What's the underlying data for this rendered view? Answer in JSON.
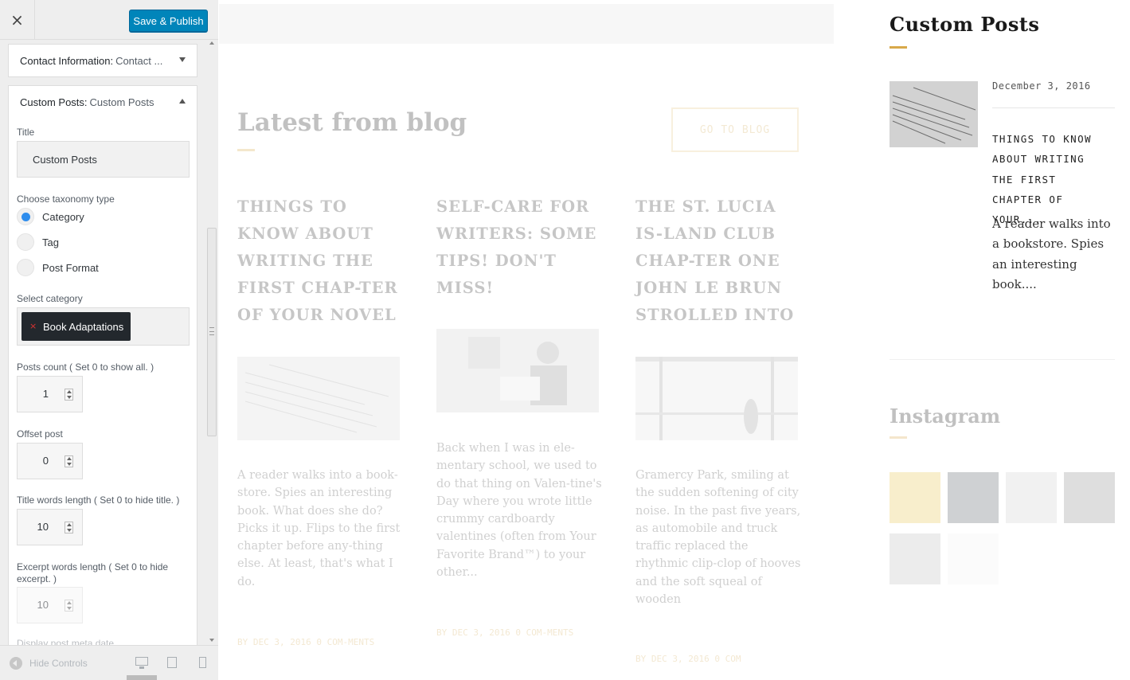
{
  "customizer": {
    "close_icon": "×",
    "publish_label": "Save & Publish",
    "contact_section": {
      "title": "Contact Information:",
      "subtitle": "Contact ..."
    },
    "custom_section": {
      "title": "Custom Posts:",
      "subtitle": "Custom Posts"
    },
    "title_label": "Title",
    "title_value": "Custom Posts",
    "taxonomy_label": "Choose taxonomy type",
    "taxonomy_options": [
      "Category",
      "Tag",
      "Post Format"
    ],
    "taxonomy_selected": "Category",
    "select_category_label": "Select category",
    "selected_category": "Book Adaptations",
    "chip_remove": "×",
    "posts_count_label": "Posts count ( Set 0 to show all. )",
    "posts_count_value": "1",
    "offset_label": "Offset post",
    "offset_value": "0",
    "title_words_label": "Title words length ( Set 0 to hide title. )",
    "title_words_value": "10",
    "excerpt_words_label": "Excerpt words length ( Set 0 to hide excerpt. )",
    "excerpt_words_value": "10",
    "cut_label": "Display post meta date",
    "hide_controls": "Hide Controls"
  },
  "preview": {
    "blog_title": "Latest from blog",
    "goto_button": "GO TO BLOG",
    "posts": [
      {
        "title": "THINGS TO KNOW ABOUT WRITING THE FIRST CHAP-TER OF YOUR NOVEL",
        "excerpt": "A reader walks into a book-store. Spies an interesting book. What does she do? Picks it up. Flips to the first chapter before any-thing else. At least, that's what I do.",
        "meta": "BY  DEC 3, 2016  0 COM-MENTS"
      },
      {
        "title": "SELF-CARE FOR WRITERS: SOME TIPS! DON'T MISS!",
        "excerpt": "Back when I was in ele-mentary school, we used to do that thing on Valen-tine's Day where you wrote little crummy cardboardy valentines (often from Your Favorite Brand™) to your other...",
        "meta": "BY  DEC 3, 2016  0 COM-MENTS"
      },
      {
        "title": "THE ST. LUCIA IS-LAND CLUB CHAP-TER ONE JOHN LE BRUN STROLLED INTO",
        "excerpt": "Gramercy Park, smiling at the sudden softening of city noise. In the past five years, as automobile and truck traffic replaced the rhythmic clip-clop of hooves and the soft squeal of wooden",
        "meta": "BY  DEC 3, 2016  0 COM"
      }
    ],
    "widget": {
      "title": "Custom Posts",
      "date": "December 3, 2016",
      "post_title": "THINGS TO KNOW ABOUT WRITING THE FIRST CHAPTER OF YOUR...",
      "excerpt": "A reader walks into a bookstore. Spies an interesting book....",
      "instagram_title": "Instagram"
    }
  },
  "colors": {
    "accent": "#0085ba",
    "gold": "#d8a94a",
    "radio": "#2e8ded"
  }
}
